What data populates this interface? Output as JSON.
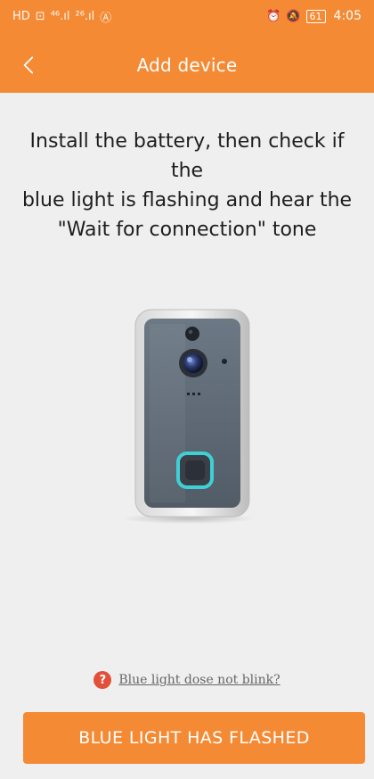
{
  "status_bar": {
    "left_icons": [
      "HD",
      "⊡",
      "⁴⁶.ıl",
      "²⁶.ıl",
      "Ⓐ"
    ],
    "right_icons": [
      "⏰",
      "🔕"
    ],
    "battery": "61",
    "time": "4:05"
  },
  "header": {
    "title": "Add device",
    "back_icon": "chevron-left-icon"
  },
  "instruction": {
    "line1": "Install the battery, then check if the",
    "line2": "blue light is flashing and hear the",
    "line3": "\"Wait for connection\" tone"
  },
  "help": {
    "icon_text": "?",
    "link_text": "Blue light dose not blink?"
  },
  "primary_button": {
    "label": "BLUE LIGHT HAS FLASHED"
  },
  "colors": {
    "accent": "#f58a35",
    "background": "#efefef",
    "help_icon": "#e2503a",
    "doorbell_ring": "#3fd0d6"
  }
}
